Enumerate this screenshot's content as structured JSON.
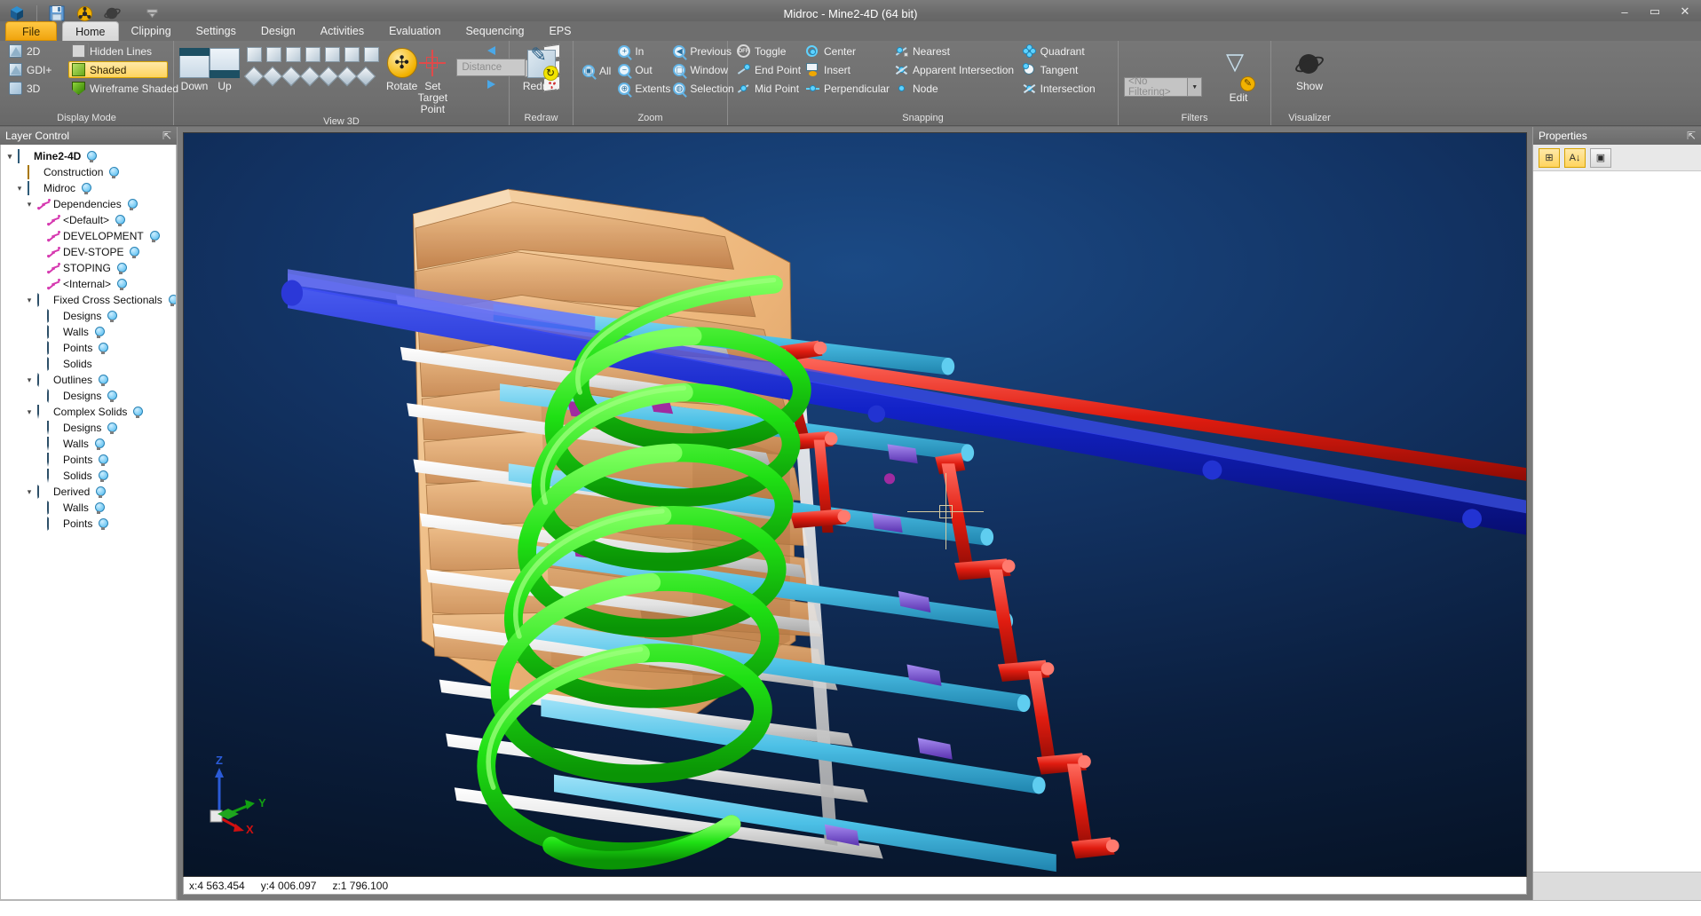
{
  "window": {
    "title": "Midroc - Mine2-4D (64 bit)",
    "minimize_label": "–",
    "maximize_label": "▭",
    "close_label": "✕"
  },
  "quick_access": {
    "items": [
      {
        "name": "app-cube-icon",
        "label": "Mine2-4D"
      },
      {
        "name": "save-icon",
        "label": "Save"
      },
      {
        "name": "network-icon",
        "label": "Network"
      },
      {
        "name": "globe-icon",
        "label": "Globe"
      },
      {
        "name": "customize-qat-icon",
        "label": "Customize Quick Access Toolbar"
      }
    ]
  },
  "ribbon": {
    "tabs": [
      {
        "label": "File",
        "state": "file"
      },
      {
        "label": "Home",
        "state": "active"
      },
      {
        "label": "Clipping",
        "state": "normal"
      },
      {
        "label": "Settings",
        "state": "normal"
      },
      {
        "label": "Design",
        "state": "normal"
      },
      {
        "label": "Activities",
        "state": "normal"
      },
      {
        "label": "Evaluation",
        "state": "normal"
      },
      {
        "label": "Sequencing",
        "state": "normal"
      },
      {
        "label": "EPS",
        "state": "normal"
      }
    ],
    "groups": {
      "display_mode": {
        "title": "Display Mode",
        "col1": [
          {
            "label": "2D",
            "icon": "triangle-2d-icon",
            "selected": false
          },
          {
            "label": "GDI+",
            "icon": "triangle-gdi-icon",
            "selected": false
          },
          {
            "label": "3D",
            "icon": "cube-3d-icon",
            "selected": false
          }
        ],
        "col2": [
          {
            "label": "Hidden Lines",
            "icon": "hidden-lines-icon",
            "selected": false
          },
          {
            "label": "Shaded",
            "icon": "shaded-cube-icon",
            "selected": true
          },
          {
            "label": "Wireframe Shaded",
            "icon": "wireframe-shaded-icon",
            "selected": false
          }
        ]
      },
      "view3d": {
        "title": "View 3D",
        "big_buttons": [
          {
            "label": "Down",
            "icon": "cube-down-icon"
          },
          {
            "label": "Up",
            "icon": "cube-up-icon"
          },
          {
            "label": "Rotate",
            "icon": "rotate-icon"
          },
          {
            "label": "Set Target Point",
            "icon": "set-target-point-icon"
          }
        ],
        "view_grid_row1": [
          "view-cube-1",
          "view-cube-2",
          "view-cube-3",
          "view-cube-4",
          "view-cube-5",
          "view-cube-6",
          "view-cube-7"
        ],
        "view_grid_row2": [
          "view-diamond-1",
          "view-diamond-2",
          "view-diamond-3",
          "view-diamond-4",
          "view-diamond-5",
          "view-diamond-6",
          "view-diamond-7"
        ],
        "distance_placeholder": "Distance",
        "distance_value": "",
        "nav_prev_icon": "arrow-left-icon",
        "nav_next_icon": "arrow-right-icon",
        "card_icons": [
          "card-one-point-icon",
          "card-two-point-icon",
          "card-three-point-icon"
        ]
      },
      "redraw": {
        "title": "Redraw",
        "button": {
          "label": "Redraw",
          "icon": "redraw-icon"
        }
      },
      "zoom": {
        "title": "Zoom",
        "all": {
          "label": "All",
          "icon": "zoom-all-icon"
        },
        "col1": [
          {
            "label": "In",
            "icon": "zoom-in-icon"
          },
          {
            "label": "Out",
            "icon": "zoom-out-icon"
          },
          {
            "label": "Extents",
            "icon": "zoom-extents-icon"
          }
        ],
        "col2": [
          {
            "label": "Previous",
            "icon": "zoom-previous-icon"
          },
          {
            "label": "Window",
            "icon": "zoom-window-icon"
          },
          {
            "label": "Selection",
            "icon": "zoom-selection-icon"
          }
        ]
      },
      "snapping": {
        "title": "Snapping",
        "col1": [
          {
            "label": "Toggle",
            "icon": "snap-toggle-icon"
          },
          {
            "label": "End Point",
            "icon": "snap-end-point-icon"
          },
          {
            "label": "Mid Point",
            "icon": "snap-mid-point-icon"
          }
        ],
        "col2": [
          {
            "label": "Center",
            "icon": "snap-center-icon"
          },
          {
            "label": "Insert",
            "icon": "snap-insert-icon"
          },
          {
            "label": "Perpendicular",
            "icon": "snap-perpendicular-icon"
          }
        ],
        "col3": [
          {
            "label": "Nearest",
            "icon": "snap-nearest-icon"
          },
          {
            "label": "Apparent Intersection",
            "icon": "snap-apparent-intersection-icon"
          },
          {
            "label": "Node",
            "icon": "snap-node-icon"
          }
        ],
        "col4": [
          {
            "label": "Quadrant",
            "icon": "snap-quadrant-icon"
          },
          {
            "label": "Tangent",
            "icon": "snap-tangent-icon"
          },
          {
            "label": "Intersection",
            "icon": "snap-intersection-icon"
          }
        ]
      },
      "filters": {
        "title": "Filters",
        "combo_value": "<No Filtering>",
        "edit_button": {
          "label": "Edit",
          "icon": "filter-edit-icon"
        }
      },
      "visualizer": {
        "title": "Visualizer",
        "show_button": {
          "label": "Show",
          "icon": "visualizer-show-icon"
        }
      }
    }
  },
  "left_dock": {
    "title": "Layer Control",
    "pin_icon": "pin-icon",
    "tree": [
      {
        "label": "Mine2-4D",
        "depth": 0,
        "icon": "cube-icon",
        "expander": "▾",
        "bulb": true,
        "bold": true
      },
      {
        "label": "Construction",
        "depth": 1,
        "icon": "construction-icon",
        "expander": "",
        "bulb": true,
        "bold": false
      },
      {
        "label": "Midroc",
        "depth": 1,
        "icon": "cube-icon",
        "expander": "▾",
        "bulb": true,
        "bold": false
      },
      {
        "label": "Dependencies",
        "depth": 2,
        "icon": "polyline-icon",
        "expander": "▾",
        "bulb": true,
        "bold": false
      },
      {
        "label": "<Default>",
        "depth": 3,
        "icon": "polyline-icon",
        "expander": "",
        "bulb": true,
        "bold": false
      },
      {
        "label": "DEVELOPMENT",
        "depth": 3,
        "icon": "polyline-icon",
        "expander": "",
        "bulb": true,
        "bold": false
      },
      {
        "label": "DEV-STOPE",
        "depth": 3,
        "icon": "polyline-icon",
        "expander": "",
        "bulb": true,
        "bold": false
      },
      {
        "label": "STOPING",
        "depth": 3,
        "icon": "polyline-icon",
        "expander": "",
        "bulb": true,
        "bold": false
      },
      {
        "label": "<Internal>",
        "depth": 3,
        "icon": "polyline-icon",
        "expander": "",
        "bulb": true,
        "bold": false
      },
      {
        "label": "Fixed Cross Sectionals",
        "depth": 2,
        "icon": "solid-icon",
        "expander": "▾",
        "bulb": true,
        "bold": false
      },
      {
        "label": "Designs",
        "depth": 3,
        "icon": "solid-icon",
        "expander": "",
        "bulb": true,
        "bold": false
      },
      {
        "label": "Walls",
        "depth": 3,
        "icon": "solid-icon",
        "expander": "",
        "bulb": true,
        "bold": false
      },
      {
        "label": "Points",
        "depth": 3,
        "icon": "solid-icon",
        "expander": "",
        "bulb": true,
        "bold": false
      },
      {
        "label": "Solids",
        "depth": 3,
        "icon": "solid-icon",
        "expander": "",
        "bulb": false,
        "bold": false
      },
      {
        "label": "Outlines",
        "depth": 2,
        "icon": "outline-icon",
        "expander": "▾",
        "bulb": true,
        "bold": false
      },
      {
        "label": "Designs",
        "depth": 3,
        "icon": "outline-icon",
        "expander": "",
        "bulb": true,
        "bold": false
      },
      {
        "label": "Complex Solids",
        "depth": 2,
        "icon": "shield-icon",
        "expander": "▾",
        "bulb": true,
        "bold": false
      },
      {
        "label": "Designs",
        "depth": 3,
        "icon": "shield-icon",
        "expander": "",
        "bulb": true,
        "bold": false
      },
      {
        "label": "Walls",
        "depth": 3,
        "icon": "shield-icon",
        "expander": "",
        "bulb": true,
        "bold": false
      },
      {
        "label": "Points",
        "depth": 3,
        "icon": "shield-icon",
        "expander": "",
        "bulb": true,
        "bold": false
      },
      {
        "label": "Solids",
        "depth": 3,
        "icon": "shield-icon",
        "expander": "",
        "bulb": true,
        "bold": false
      },
      {
        "label": "Derived",
        "depth": 2,
        "icon": "solid-icon",
        "expander": "▾",
        "bulb": true,
        "bold": false
      },
      {
        "label": "Walls",
        "depth": 3,
        "icon": "solid-icon",
        "expander": "",
        "bulb": true,
        "bold": false
      },
      {
        "label": "Points",
        "depth": 3,
        "icon": "solid-icon",
        "expander": "",
        "bulb": true,
        "bold": false
      }
    ]
  },
  "right_dock": {
    "title": "Properties",
    "pin_icon": "pin-icon",
    "buttons": [
      {
        "name": "categorized-button",
        "label": "⊞",
        "active": true
      },
      {
        "name": "alphabetical-sort-button",
        "label": "A↓",
        "active": true
      },
      {
        "name": "property-pages-button",
        "label": "▣",
        "active": false
      }
    ]
  },
  "viewport": {
    "axis": {
      "z_label": "Z",
      "y_label": "Y",
      "x_label": "X"
    },
    "status": {
      "x": "x:4 563.454",
      "y": "y:4 006.097",
      "z": "z:1 796.100"
    },
    "colors": {
      "background_top": "#1b4a85",
      "background_bottom": "#061326",
      "stope_orange": "#f2b66a",
      "ramp_green": "#22e016",
      "drive_cyan": "#4fc3ea",
      "drive_blue": "#1222c8",
      "drive_red": "#e01c10",
      "drive_white": "#f0f0f0",
      "drive_purple": "#7a4ed8",
      "drive_magenta": "#b02bb0",
      "crosshair": "#d8cba0"
    }
  }
}
